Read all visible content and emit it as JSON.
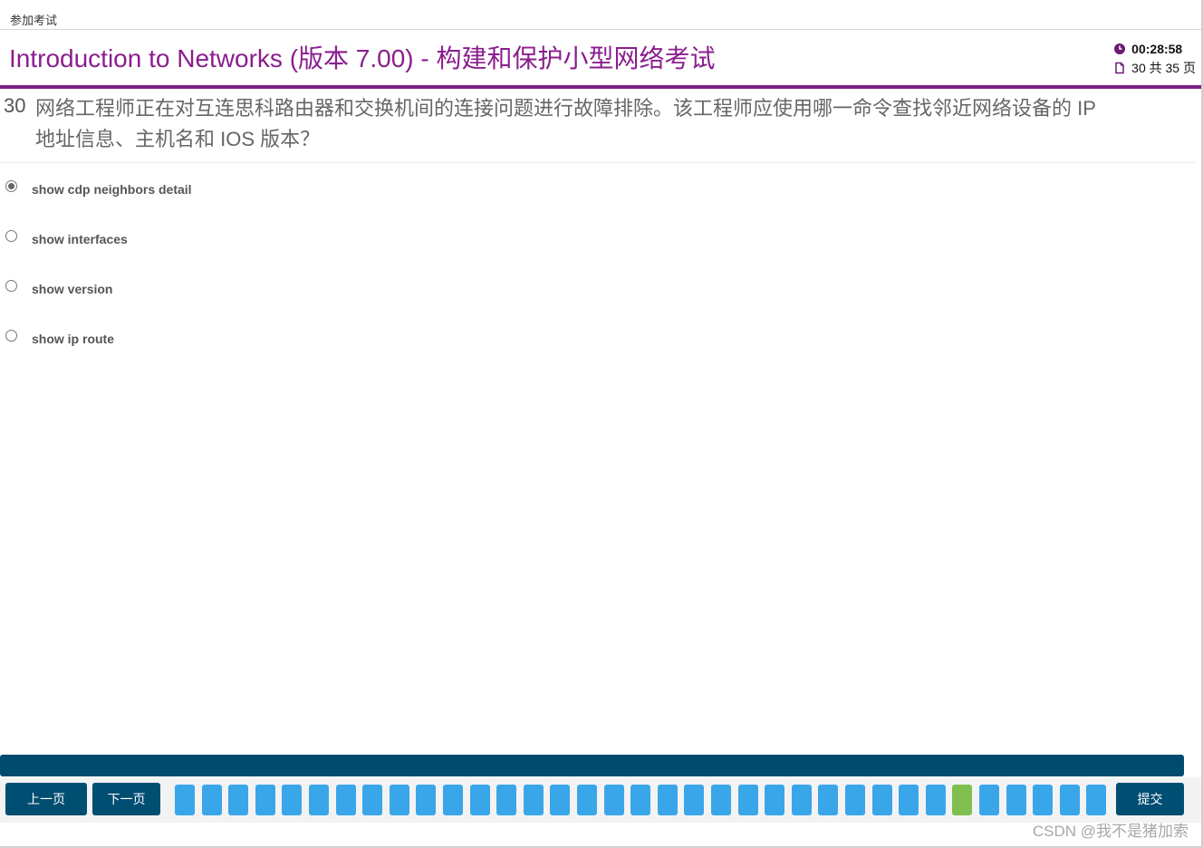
{
  "window": {
    "title": "参加考试"
  },
  "header": {
    "exam_title": "Introduction to Networks (版本 7.00) - 构建和保护小型网络考试",
    "timer": "00:28:58",
    "page_info": "30 共 35 页"
  },
  "question": {
    "number": "30",
    "text": "网络工程师正在对互连思科路由器和交换机间的连接问题进行故障排除。该工程师应使用哪一命令查找邻近网络设备的 IP 地址信息、主机名和 IOS 版本？"
  },
  "options": [
    {
      "label": "show cdp neighbors detail",
      "selected": true
    },
    {
      "label": "show interfaces",
      "selected": false
    },
    {
      "label": "show version",
      "selected": false
    },
    {
      "label": "show ip route",
      "selected": false
    }
  ],
  "navigation": {
    "prev_label": "上一页",
    "next_label": "下一页",
    "submit_label": "提交",
    "total_questions": 35,
    "current_question": 30
  },
  "colors": {
    "title_purple": "#8b1e8e",
    "rule_purple": "#7b1f82",
    "nav_blue": "#004e72",
    "cell_blue": "#3aa6ea",
    "cell_current": "#80bf4f"
  },
  "watermark": "CSDN @我不是猪加索"
}
